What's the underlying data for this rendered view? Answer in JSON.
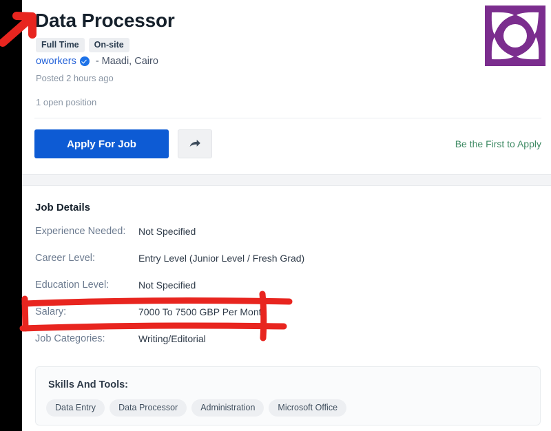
{
  "page": {
    "type": "job-posting"
  },
  "header": {
    "title": "Data Processor",
    "badges": [
      "Full Time",
      "On-site"
    ],
    "company": "oworkers",
    "verified_icon": "verified-badge-icon",
    "location": "- Maadi, Cairo",
    "posted": "Posted 2 hours ago",
    "open_positions": "1 open position",
    "apply_label": "Apply For Job",
    "share_icon": "share-arrow-icon",
    "first_to_apply": "Be the First to Apply",
    "logo_alt": "company-logo"
  },
  "details": {
    "section_title": "Job Details",
    "rows": [
      {
        "label": "Experience Needed:",
        "value": "Not Specified"
      },
      {
        "label": "Career Level:",
        "value": "Entry Level (Junior Level / Fresh Grad)"
      },
      {
        "label": "Education Level:",
        "value": "Not Specified"
      },
      {
        "label": "Salary:",
        "value": "7000 To 7500 GBP Per Month"
      },
      {
        "label": "Job Categories:",
        "value": "Writing/Editorial"
      }
    ]
  },
  "skills": {
    "title": "Skills And Tools:",
    "items": [
      "Data Entry",
      "Data Processor",
      "Administration",
      "Microsoft Office"
    ]
  },
  "annotations": {
    "arrow": {
      "name": "red-arrow-annotation",
      "target": "job-title"
    },
    "box": {
      "name": "red-box-annotation",
      "target": "salary-row"
    },
    "color": "#e8251f"
  },
  "colors": {
    "accent_blue": "#0d5bd4",
    "link_blue": "#2563d9",
    "green": "#3e8a63",
    "logo_purple": "#7b2d8e",
    "annotation_red": "#e8251f",
    "gutter_black": "#000000"
  }
}
